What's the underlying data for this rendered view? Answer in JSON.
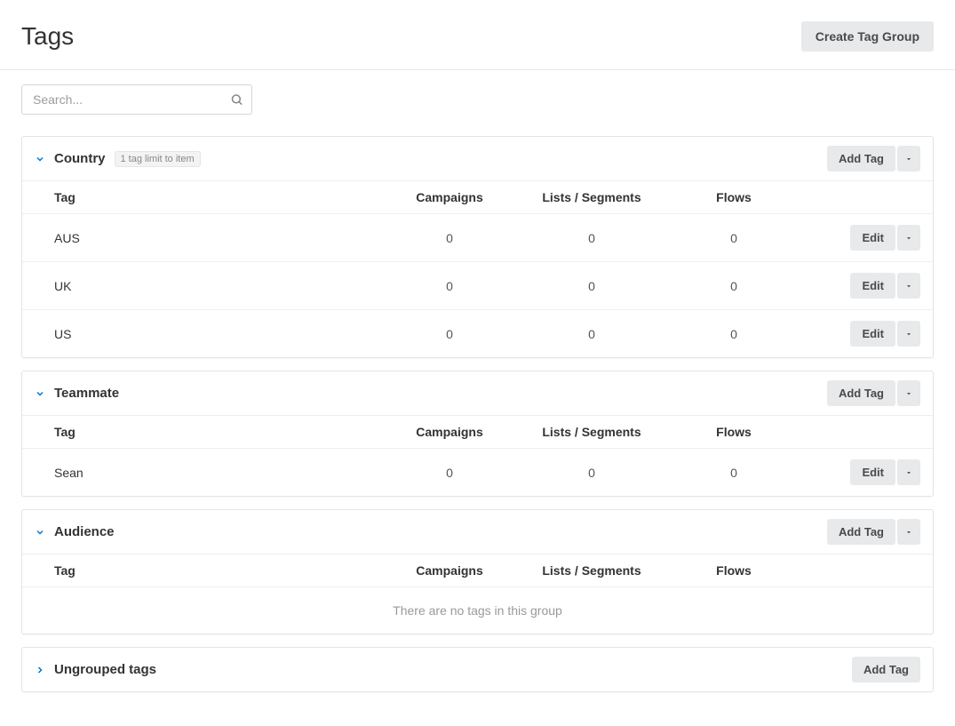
{
  "header": {
    "title": "Tags",
    "create_button": "Create Tag Group"
  },
  "search": {
    "placeholder": "Search..."
  },
  "columns": {
    "tag": "Tag",
    "campaigns": "Campaigns",
    "lists_segments": "Lists / Segments",
    "flows": "Flows"
  },
  "buttons": {
    "add_tag": "Add Tag",
    "edit": "Edit"
  },
  "empty_group_text": "There are no tags in this group",
  "groups": [
    {
      "id": "country",
      "title": "Country",
      "badge": "1 tag limit to item",
      "expanded": true,
      "has_dropdown": true,
      "tags": [
        {
          "name": "AUS",
          "campaigns": 0,
          "lists_segments": 0,
          "flows": 0
        },
        {
          "name": "UK",
          "campaigns": 0,
          "lists_segments": 0,
          "flows": 0
        },
        {
          "name": "US",
          "campaigns": 0,
          "lists_segments": 0,
          "flows": 0
        }
      ]
    },
    {
      "id": "teammate",
      "title": "Teammate",
      "badge": null,
      "expanded": true,
      "has_dropdown": true,
      "tags": [
        {
          "name": "Sean",
          "campaigns": 0,
          "lists_segments": 0,
          "flows": 0
        }
      ]
    },
    {
      "id": "audience",
      "title": "Audience",
      "badge": null,
      "expanded": true,
      "has_dropdown": true,
      "tags": []
    },
    {
      "id": "ungrouped",
      "title": "Ungrouped tags",
      "badge": null,
      "expanded": false,
      "has_dropdown": false,
      "tags": []
    }
  ]
}
